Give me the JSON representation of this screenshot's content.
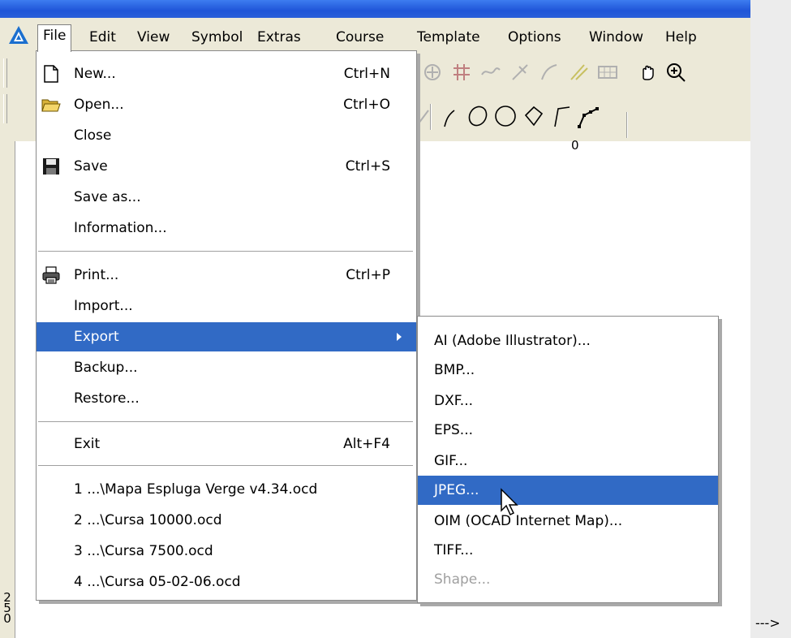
{
  "app": {
    "menus": [
      "File",
      "Edit",
      "View",
      "Symbol",
      "Extras",
      "Course",
      "Template",
      "Options",
      "Window",
      "Help"
    ],
    "active_menu": "File"
  },
  "ruler": {
    "top_zero": "0",
    "left_label": "250"
  },
  "file_menu": {
    "items": [
      {
        "label": "New...",
        "shortcut": "Ctrl+N",
        "icon": "new-document-icon"
      },
      {
        "label": "Open...",
        "shortcut": "Ctrl+O",
        "icon": "open-folder-icon"
      },
      {
        "label": "Close",
        "shortcut": ""
      },
      {
        "label": "Save",
        "shortcut": "Ctrl+S",
        "icon": "save-disk-icon"
      },
      {
        "label": "Save as...",
        "shortcut": ""
      },
      {
        "label": "Information...",
        "shortcut": ""
      },
      {
        "label": "Print...",
        "shortcut": "Ctrl+P",
        "icon": "printer-icon"
      },
      {
        "label": "Import...",
        "shortcut": ""
      },
      {
        "label": "Export",
        "shortcut": "",
        "submenu": true,
        "highlighted": true
      },
      {
        "label": "Backup...",
        "shortcut": ""
      },
      {
        "label": "Restore...",
        "shortcut": ""
      },
      {
        "label": "Exit",
        "shortcut": "Alt+F4"
      },
      {
        "label": "1 ...\\Mapa Espluga Verge v4.34.ocd"
      },
      {
        "label": "2 ...\\Cursa 10000.ocd"
      },
      {
        "label": "3 ...\\Cursa 7500.ocd"
      },
      {
        "label": "4 ...\\Cursa 05-02-06.ocd"
      }
    ]
  },
  "export_menu": {
    "items": [
      {
        "label": "AI (Adobe Illustrator)..."
      },
      {
        "label": "BMP..."
      },
      {
        "label": "DXF..."
      },
      {
        "label": "EPS..."
      },
      {
        "label": "GIF..."
      },
      {
        "label": "JPEG...",
        "highlighted": true
      },
      {
        "label": "OIM (OCAD Internet Map)..."
      },
      {
        "label": "TIFF..."
      },
      {
        "label": "Shape...",
        "disabled": true
      }
    ]
  },
  "corner_text": "--->",
  "colors": {
    "highlight": "#316ac5",
    "menubar": "#ece9d8",
    "titlebar": "#2a5fd9"
  }
}
